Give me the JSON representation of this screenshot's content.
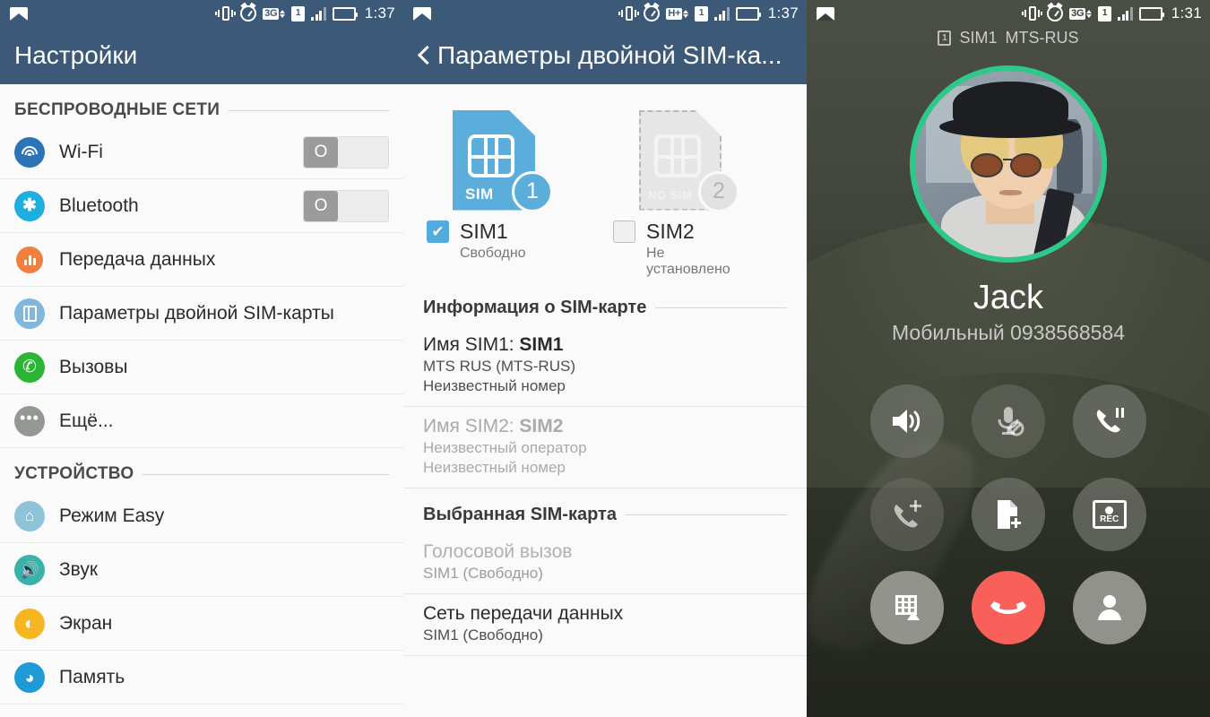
{
  "screens": {
    "settings": {
      "statusbar": {
        "photo_icon": "photo-icon",
        "vibrate_icon": "vibrate-icon",
        "alarm_icon": "alarm-icon",
        "network": "3G",
        "sim_slot": "1",
        "time": "1:37"
      },
      "appbar": {
        "title": "Настройки"
      },
      "sections": [
        {
          "title": "БЕСПРОВОДНЫЕ СЕТИ",
          "items": [
            {
              "label": "Wi-Fi",
              "icon": "wifi-icon",
              "color": "#2c74b8",
              "toggle": "O"
            },
            {
              "label": "Bluetooth",
              "icon": "bluetooth-icon",
              "color": "#1eaee0",
              "toggle": "O"
            },
            {
              "label": "Передача данных",
              "icon": "data-usage-icon",
              "color": "#f08040"
            },
            {
              "label": "Параметры двойной SIM-карты",
              "icon": "dual-sim-icon",
              "color": "#7fb8dc"
            },
            {
              "label": "Вызовы",
              "icon": "phone-icon",
              "color": "#2bb534"
            },
            {
              "label": "Ещё...",
              "icon": "more-icon",
              "color": "#939992"
            }
          ]
        },
        {
          "title": "УСТРОЙСТВО",
          "items": [
            {
              "label": "Режим Easy",
              "icon": "home-icon",
              "color": "#8ec4d8"
            },
            {
              "label": "Звук",
              "icon": "sound-icon",
              "color": "#39b3aa"
            },
            {
              "label": "Экран",
              "icon": "display-icon",
              "color": "#f5b622"
            },
            {
              "label": "Память",
              "icon": "storage-icon",
              "color": "#1e9ad6"
            }
          ]
        }
      ]
    },
    "dual_sim": {
      "statusbar": {
        "network": "H+",
        "sim_slot": "1",
        "time": "1:37"
      },
      "appbar": {
        "back_icon": "back-chevron-icon",
        "title": "Параметры двойной SIM-ка..."
      },
      "sim_cards": [
        {
          "card_label": "SIM",
          "number": "1",
          "checkbox_label": "SIM1",
          "status": "Свободно",
          "checked": true,
          "installed": true
        },
        {
          "card_label": "NO SIM",
          "number": "2",
          "checkbox_label": "SIM2",
          "status": "Не установлено",
          "checked": false,
          "installed": false
        }
      ],
      "info_section": {
        "title": "Информация о SIM-карте",
        "entries": [
          {
            "label": "Имя SIM1: ",
            "value": "SIM1",
            "operator": "MTS RUS (MTS-RUS)",
            "number": "Неизвестный номер"
          },
          {
            "label": "Имя SIM2: ",
            "value": "SIM2",
            "operator": "Неизвестный оператор",
            "number": "Неизвестный номер"
          }
        ]
      },
      "selected_section": {
        "title": "Выбранная SIM-карта",
        "entries": [
          {
            "label": "Голосовой вызов",
            "value": "SIM1 (Свободно)"
          },
          {
            "label": "Сеть передачи данных",
            "value": "SIM1 (Свободно)"
          }
        ]
      }
    },
    "call": {
      "statusbar": {
        "network": "3G",
        "sim_slot": "1",
        "time": "1:31"
      },
      "sim_indicator": {
        "slot": "1",
        "sim": "SIM1",
        "operator": "MTS-RUS"
      },
      "avatar": {
        "name": "avatar",
        "ring_color": "#2dc98a"
      },
      "caller_name": "Jack",
      "caller_number": "Мобильный 0938568584",
      "buttons": [
        {
          "name": "speaker-button",
          "icon": "speaker-icon",
          "style": "normal"
        },
        {
          "name": "mute-button",
          "icon": "microphone-off-icon",
          "style": "dim"
        },
        {
          "name": "hold-button",
          "icon": "phone-pause-icon",
          "style": "normal"
        },
        {
          "name": "add-call-button",
          "icon": "phone-add-icon",
          "style": "dim"
        },
        {
          "name": "add-note-button",
          "icon": "note-add-icon",
          "style": "normal"
        },
        {
          "name": "record-button",
          "icon": "record-icon",
          "label": "REC",
          "style": "normal"
        },
        {
          "name": "dialpad-button",
          "icon": "dialpad-icon",
          "style": "light"
        },
        {
          "name": "end-call-button",
          "icon": "phone-hangup-icon",
          "style": "end"
        },
        {
          "name": "contacts-button",
          "icon": "person-icon",
          "style": "light"
        }
      ]
    }
  },
  "colors": {
    "appbar": "#3c5a78",
    "accent_green": "#2dc98a",
    "end_call_red": "#f9605a",
    "sim_blue": "#5baddb"
  }
}
